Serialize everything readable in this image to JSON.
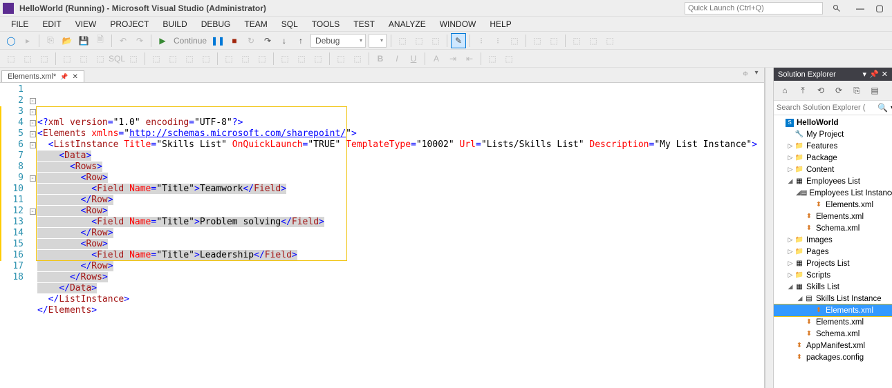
{
  "titlebar": {
    "title": "HelloWorld (Running) - Microsoft Visual Studio (Administrator)",
    "quick_launch_placeholder": "Quick Launch (Ctrl+Q)"
  },
  "menu": [
    "FILE",
    "EDIT",
    "VIEW",
    "PROJECT",
    "BUILD",
    "DEBUG",
    "TEAM",
    "SQL",
    "TOOLS",
    "TEST",
    "ANALYZE",
    "WINDOW",
    "HELP"
  ],
  "toolbar1": {
    "continue_label": "Continue",
    "config_combo": "Debug"
  },
  "tab": {
    "name": "Elements.xml*"
  },
  "code": {
    "lines": [
      {
        "n": 1,
        "y": false,
        "fold": "",
        "segs": [
          {
            "t": "<?",
            "c": "c-blue"
          },
          {
            "t": "xml version",
            "c": "c-brown"
          },
          {
            "t": "=",
            "c": "c-blue"
          },
          {
            "t": "\"1.0\"",
            "c": "c-black"
          },
          {
            "t": " ",
            "c": ""
          },
          {
            "t": "encoding",
            "c": "c-brown"
          },
          {
            "t": "=",
            "c": "c-blue"
          },
          {
            "t": "\"UTF-8\"",
            "c": "c-black"
          },
          {
            "t": "?>",
            "c": "c-blue"
          }
        ]
      },
      {
        "n": 2,
        "y": false,
        "fold": "-",
        "segs": [
          {
            "t": "<",
            "c": "c-blue"
          },
          {
            "t": "Elements ",
            "c": "c-brown"
          },
          {
            "t": "xmlns",
            "c": "c-red"
          },
          {
            "t": "=",
            "c": "c-blue"
          },
          {
            "t": "\"",
            "c": "c-black"
          },
          {
            "t": "http://schemas.microsoft.com/sharepoint/",
            "c": "c-link"
          },
          {
            "t": "\"",
            "c": "c-black"
          },
          {
            "t": ">",
            "c": "c-blue"
          }
        ]
      },
      {
        "n": 3,
        "y": true,
        "fold": "-",
        "segs": [
          {
            "t": "  ",
            "c": ""
          },
          {
            "t": "<",
            "c": "c-blue"
          },
          {
            "t": "ListInstance ",
            "c": "c-brown"
          },
          {
            "t": "Title",
            "c": "c-red"
          },
          {
            "t": "=",
            "c": "c-blue"
          },
          {
            "t": "\"Skills List\"",
            "c": "c-black"
          },
          {
            "t": " ",
            "c": ""
          },
          {
            "t": "OnQuickLaunch",
            "c": "c-red"
          },
          {
            "t": "=",
            "c": "c-blue"
          },
          {
            "t": "\"TRUE\"",
            "c": "c-black"
          },
          {
            "t": " ",
            "c": ""
          },
          {
            "t": "TemplateType",
            "c": "c-red"
          },
          {
            "t": "=",
            "c": "c-blue"
          },
          {
            "t": "\"10002\"",
            "c": "c-black"
          },
          {
            "t": " ",
            "c": ""
          },
          {
            "t": "Url",
            "c": "c-red"
          },
          {
            "t": "=",
            "c": "c-blue"
          },
          {
            "t": "\"Lists/Skills List\"",
            "c": "c-black"
          },
          {
            "t": " ",
            "c": ""
          },
          {
            "t": "Description",
            "c": "c-red"
          },
          {
            "t": "=",
            "c": "c-blue"
          },
          {
            "t": "\"My List Instance\"",
            "c": "c-black"
          },
          {
            "t": ">",
            "c": "c-blue"
          }
        ]
      },
      {
        "n": 4,
        "y": true,
        "fold": "-",
        "sel": true,
        "segs": [
          {
            "t": "    ",
            "c": ""
          },
          {
            "t": "<",
            "c": "c-blue"
          },
          {
            "t": "Data",
            "c": "c-brown"
          },
          {
            "t": ">",
            "c": "c-blue"
          }
        ]
      },
      {
        "n": 5,
        "y": true,
        "fold": "-",
        "sel": true,
        "segs": [
          {
            "t": "      ",
            "c": ""
          },
          {
            "t": "<",
            "c": "c-blue"
          },
          {
            "t": "Rows",
            "c": "c-brown"
          },
          {
            "t": ">",
            "c": "c-blue"
          }
        ]
      },
      {
        "n": 6,
        "y": true,
        "fold": "-",
        "sel": true,
        "segs": [
          {
            "t": "        ",
            "c": ""
          },
          {
            "t": "<",
            "c": "c-blue"
          },
          {
            "t": "Row",
            "c": "c-brown"
          },
          {
            "t": ">",
            "c": "c-blue"
          }
        ]
      },
      {
        "n": 7,
        "y": true,
        "fold": "",
        "sel": true,
        "segs": [
          {
            "t": "          ",
            "c": ""
          },
          {
            "t": "<",
            "c": "c-blue"
          },
          {
            "t": "Field ",
            "c": "c-brown"
          },
          {
            "t": "Name",
            "c": "c-red"
          },
          {
            "t": "=",
            "c": "c-blue"
          },
          {
            "t": "\"Title\"",
            "c": "c-black"
          },
          {
            "t": ">",
            "c": "c-blue"
          },
          {
            "t": "Teamwork",
            "c": "c-black"
          },
          {
            "t": "</",
            "c": "c-blue"
          },
          {
            "t": "Field",
            "c": "c-brown"
          },
          {
            "t": ">",
            "c": "c-blue"
          }
        ]
      },
      {
        "n": 8,
        "y": true,
        "fold": "",
        "sel": true,
        "segs": [
          {
            "t": "        ",
            "c": ""
          },
          {
            "t": "</",
            "c": "c-blue"
          },
          {
            "t": "Row",
            "c": "c-brown"
          },
          {
            "t": ">",
            "c": "c-blue"
          }
        ]
      },
      {
        "n": 9,
        "y": true,
        "fold": "-",
        "sel": true,
        "segs": [
          {
            "t": "        ",
            "c": ""
          },
          {
            "t": "<",
            "c": "c-blue"
          },
          {
            "t": "Row",
            "c": "c-brown"
          },
          {
            "t": ">",
            "c": "c-blue"
          }
        ]
      },
      {
        "n": 10,
        "y": true,
        "fold": "",
        "sel": true,
        "segs": [
          {
            "t": "          ",
            "c": ""
          },
          {
            "t": "<",
            "c": "c-blue"
          },
          {
            "t": "Field ",
            "c": "c-brown"
          },
          {
            "t": "Name",
            "c": "c-red"
          },
          {
            "t": "=",
            "c": "c-blue"
          },
          {
            "t": "\"Title\"",
            "c": "c-black"
          },
          {
            "t": ">",
            "c": "c-blue"
          },
          {
            "t": "Problem solving",
            "c": "c-black"
          },
          {
            "t": "</",
            "c": "c-blue"
          },
          {
            "t": "Field",
            "c": "c-brown"
          },
          {
            "t": ">",
            "c": "c-blue"
          }
        ]
      },
      {
        "n": 11,
        "y": true,
        "fold": "",
        "sel": true,
        "segs": [
          {
            "t": "        ",
            "c": ""
          },
          {
            "t": "</",
            "c": "c-blue"
          },
          {
            "t": "Row",
            "c": "c-brown"
          },
          {
            "t": ">",
            "c": "c-blue"
          }
        ]
      },
      {
        "n": 12,
        "y": true,
        "fold": "-",
        "sel": true,
        "segs": [
          {
            "t": "        ",
            "c": ""
          },
          {
            "t": "<",
            "c": "c-blue"
          },
          {
            "t": "Row",
            "c": "c-brown"
          },
          {
            "t": ">",
            "c": "c-blue"
          }
        ]
      },
      {
        "n": 13,
        "y": true,
        "fold": "",
        "sel": true,
        "segs": [
          {
            "t": "          ",
            "c": ""
          },
          {
            "t": "<",
            "c": "c-blue"
          },
          {
            "t": "Field ",
            "c": "c-brown"
          },
          {
            "t": "Name",
            "c": "c-red"
          },
          {
            "t": "=",
            "c": "c-blue"
          },
          {
            "t": "\"Title\"",
            "c": "c-black"
          },
          {
            "t": ">",
            "c": "c-blue"
          },
          {
            "t": "Leadership",
            "c": "c-black"
          },
          {
            "t": "</",
            "c": "c-blue"
          },
          {
            "t": "Field",
            "c": "c-brown"
          },
          {
            "t": ">",
            "c": "c-blue"
          }
        ]
      },
      {
        "n": 14,
        "y": true,
        "fold": "",
        "sel": true,
        "segs": [
          {
            "t": "        ",
            "c": ""
          },
          {
            "t": "</",
            "c": "c-blue"
          },
          {
            "t": "Row",
            "c": "c-brown"
          },
          {
            "t": ">",
            "c": "c-blue"
          }
        ]
      },
      {
        "n": 15,
        "y": true,
        "fold": "",
        "sel": true,
        "segs": [
          {
            "t": "      ",
            "c": ""
          },
          {
            "t": "</",
            "c": "c-blue"
          },
          {
            "t": "Rows",
            "c": "c-brown"
          },
          {
            "t": ">",
            "c": "c-blue"
          }
        ]
      },
      {
        "n": 16,
        "y": true,
        "fold": "",
        "sel": true,
        "segs": [
          {
            "t": "    ",
            "c": ""
          },
          {
            "t": "</",
            "c": "c-blue"
          },
          {
            "t": "Data",
            "c": "c-brown"
          },
          {
            "t": ">",
            "c": "c-blue"
          }
        ]
      },
      {
        "n": 17,
        "y": false,
        "fold": "",
        "segs": [
          {
            "t": "  ",
            "c": ""
          },
          {
            "t": "</",
            "c": "c-blue"
          },
          {
            "t": "ListInstance",
            "c": "c-brown"
          },
          {
            "t": ">",
            "c": "c-blue"
          }
        ]
      },
      {
        "n": 18,
        "y": false,
        "fold": "",
        "segs": [
          {
            "t": "</",
            "c": "c-blue"
          },
          {
            "t": "Elements",
            "c": "c-brown"
          },
          {
            "t": ">",
            "c": "c-blue"
          }
        ]
      }
    ]
  },
  "solution_explorer": {
    "title": "Solution Explorer",
    "search_placeholder": "Search Solution Explorer (",
    "tree": [
      {
        "d": 0,
        "tw": "",
        "ic": "sln",
        "lbl": "HelloWorld",
        "bold": true
      },
      {
        "d": 1,
        "tw": "",
        "ic": "wrench",
        "lbl": "My Project"
      },
      {
        "d": 1,
        "tw": "▷",
        "ic": "fold",
        "lbl": "Features"
      },
      {
        "d": 1,
        "tw": "▷",
        "ic": "fold",
        "lbl": "Package"
      },
      {
        "d": 1,
        "tw": "▷",
        "ic": "fold",
        "lbl": "Content"
      },
      {
        "d": 1,
        "tw": "◢",
        "ic": "list",
        "lbl": "Employees List"
      },
      {
        "d": 2,
        "tw": "◢",
        "ic": "grid",
        "lbl": "Employees List Instance"
      },
      {
        "d": 3,
        "tw": "",
        "ic": "xml",
        "lbl": "Elements.xml"
      },
      {
        "d": 2,
        "tw": "",
        "ic": "xml",
        "lbl": "Elements.xml"
      },
      {
        "d": 2,
        "tw": "",
        "ic": "xml",
        "lbl": "Schema.xml"
      },
      {
        "d": 1,
        "tw": "▷",
        "ic": "fold",
        "lbl": "Images"
      },
      {
        "d": 1,
        "tw": "▷",
        "ic": "fold",
        "lbl": "Pages"
      },
      {
        "d": 1,
        "tw": "▷",
        "ic": "list",
        "lbl": "Projects List"
      },
      {
        "d": 1,
        "tw": "▷",
        "ic": "fold",
        "lbl": "Scripts"
      },
      {
        "d": 1,
        "tw": "◢",
        "ic": "list",
        "lbl": "Skills List"
      },
      {
        "d": 2,
        "tw": "◢",
        "ic": "grid",
        "lbl": "Skills List Instance"
      },
      {
        "d": 3,
        "tw": "",
        "ic": "xml",
        "lbl": "Elements.xml",
        "selected": true,
        "ysel": true
      },
      {
        "d": 2,
        "tw": "",
        "ic": "xml",
        "lbl": "Elements.xml"
      },
      {
        "d": 2,
        "tw": "",
        "ic": "xml",
        "lbl": "Schema.xml"
      },
      {
        "d": 1,
        "tw": "",
        "ic": "xml",
        "lbl": "AppManifest.xml"
      },
      {
        "d": 1,
        "tw": "",
        "ic": "xml",
        "lbl": "packages.config"
      }
    ]
  }
}
